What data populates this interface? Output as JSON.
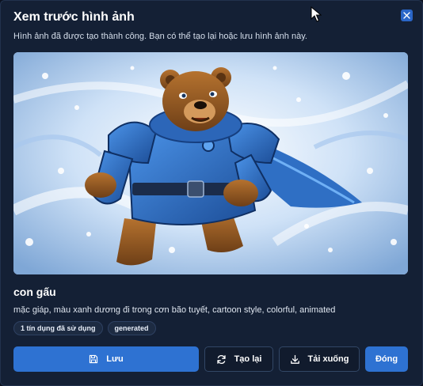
{
  "dialog": {
    "title": "Xem trước hình ảnh",
    "subtitle": "Hình ảnh đã được tạo thành công. Bạn có thể tạo lại hoặc lưu hình ảnh này."
  },
  "prompt": {
    "title": "con gấu",
    "text": "mặc giáp, màu xanh dương đi trong cơn bão tuyết, cartoon style, colorful, animated"
  },
  "tags": [
    "1 tín dụng đã sử dụng",
    "generated"
  ],
  "buttons": {
    "save": "Lưu",
    "regenerate": "Tạo lại",
    "download": "Tải xuống",
    "close": "Đóng"
  },
  "icons": {
    "close": "close-icon",
    "save": "floppy-disk-icon",
    "regenerate": "refresh-icon",
    "download": "download-icon"
  },
  "colors": {
    "accent": "#2e72d2",
    "background": "#142035",
    "armor": "#2f6fc4"
  }
}
